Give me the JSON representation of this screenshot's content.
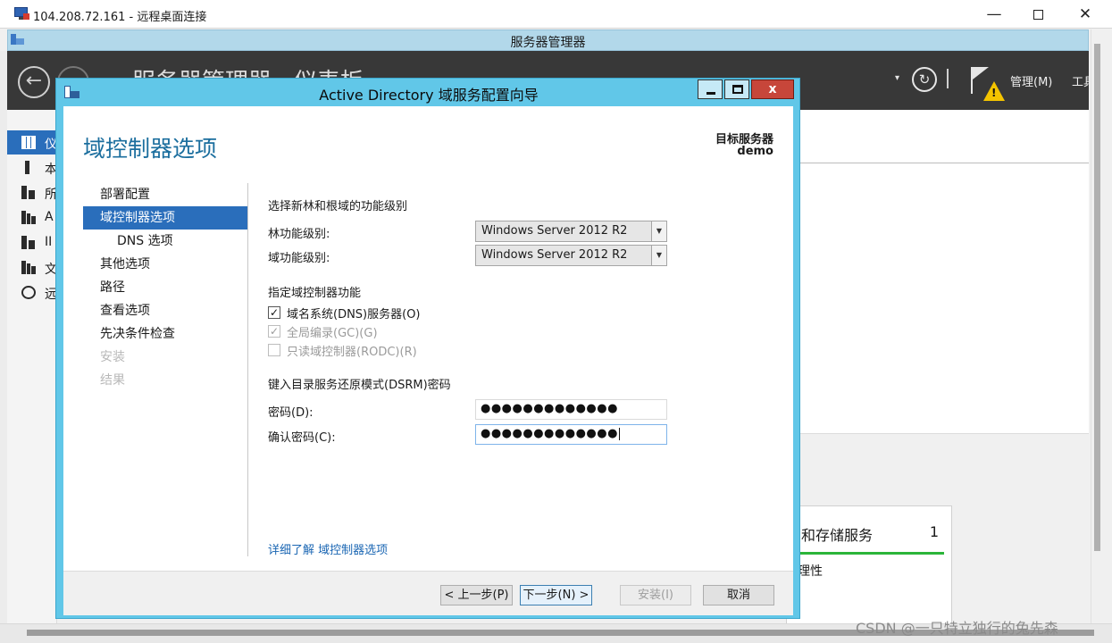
{
  "rdp": {
    "title": "104.208.72.161 - 远程桌面连接",
    "min_glyph": "—",
    "close_glyph": "✕"
  },
  "server_manager": {
    "window_title": "服务器管理器",
    "header_title": "服务器管理器 · 仪表板",
    "refresh_glyph": "↻",
    "dropdown_glyph": "▾",
    "menu_manage": "管理(M)",
    "menu_tools": "工具",
    "nav": [
      {
        "label": "仪",
        "icon": "dashboard-icon"
      },
      {
        "label": "本",
        "icon": "local-server-icon"
      },
      {
        "label": "所",
        "icon": "all-servers-icon"
      },
      {
        "label": "A",
        "icon": "ad-ds-icon"
      },
      {
        "label": "II",
        "icon": "iis-icon"
      },
      {
        "label": "文",
        "icon": "file-services-icon"
      },
      {
        "label": "远",
        "icon": "remote-icon"
      }
    ],
    "tile": {
      "name": "和存储服务",
      "count": "1",
      "sub": "理性"
    },
    "status_color": "#2bb539"
  },
  "wizard": {
    "title": "Active Directory 域服务配置向导",
    "close_label": "x",
    "heading": "域控制器选项",
    "target_label": "目标服务器",
    "target_name": "demo",
    "steps": [
      {
        "label": "部署配置",
        "state": "normal"
      },
      {
        "label": "域控制器选项",
        "state": "active"
      },
      {
        "label": "DNS 选项",
        "state": "sub"
      },
      {
        "label": "其他选项",
        "state": "normal"
      },
      {
        "label": "路径",
        "state": "normal"
      },
      {
        "label": "查看选项",
        "state": "normal"
      },
      {
        "label": "先决条件检查",
        "state": "normal"
      },
      {
        "label": "安装",
        "state": "disabled"
      },
      {
        "label": "结果",
        "state": "disabled"
      }
    ],
    "functional_level_section": "选择新林和根域的功能级别",
    "forest_level_label": "林功能级别:",
    "forest_level_value": "Windows Server 2012 R2",
    "domain_level_label": "域功能级别:",
    "domain_level_value": "Windows Server 2012 R2",
    "dc_capabilities_section": "指定域控制器功能",
    "capabilities": [
      {
        "label": "域名系统(DNS)服务器(O)",
        "checked": true,
        "enabled": true
      },
      {
        "label": "全局编录(GC)(G)",
        "checked": true,
        "enabled": false
      },
      {
        "label": "只读域控制器(RODC)(R)",
        "checked": false,
        "enabled": false
      }
    ],
    "check_glyph": "✓",
    "dsrm_section": "键入目录服务还原模式(DSRM)密码",
    "password_label": "密码(D):",
    "password_value": "●●●●●●●●●●●●●",
    "confirm_label": "确认密码(C):",
    "confirm_value": "●●●●●●●●●●●●●",
    "learn_more": "详细了解 域控制器选项",
    "buttons": {
      "prev": "< 上一步(P)",
      "next": "下一步(N) >",
      "install": "安装(I)",
      "cancel": "取消"
    },
    "accent_color": "#2a6ebb",
    "frame_color": "#61c7e8"
  },
  "watermark": "CSDN @一只特立独行的兔先森"
}
